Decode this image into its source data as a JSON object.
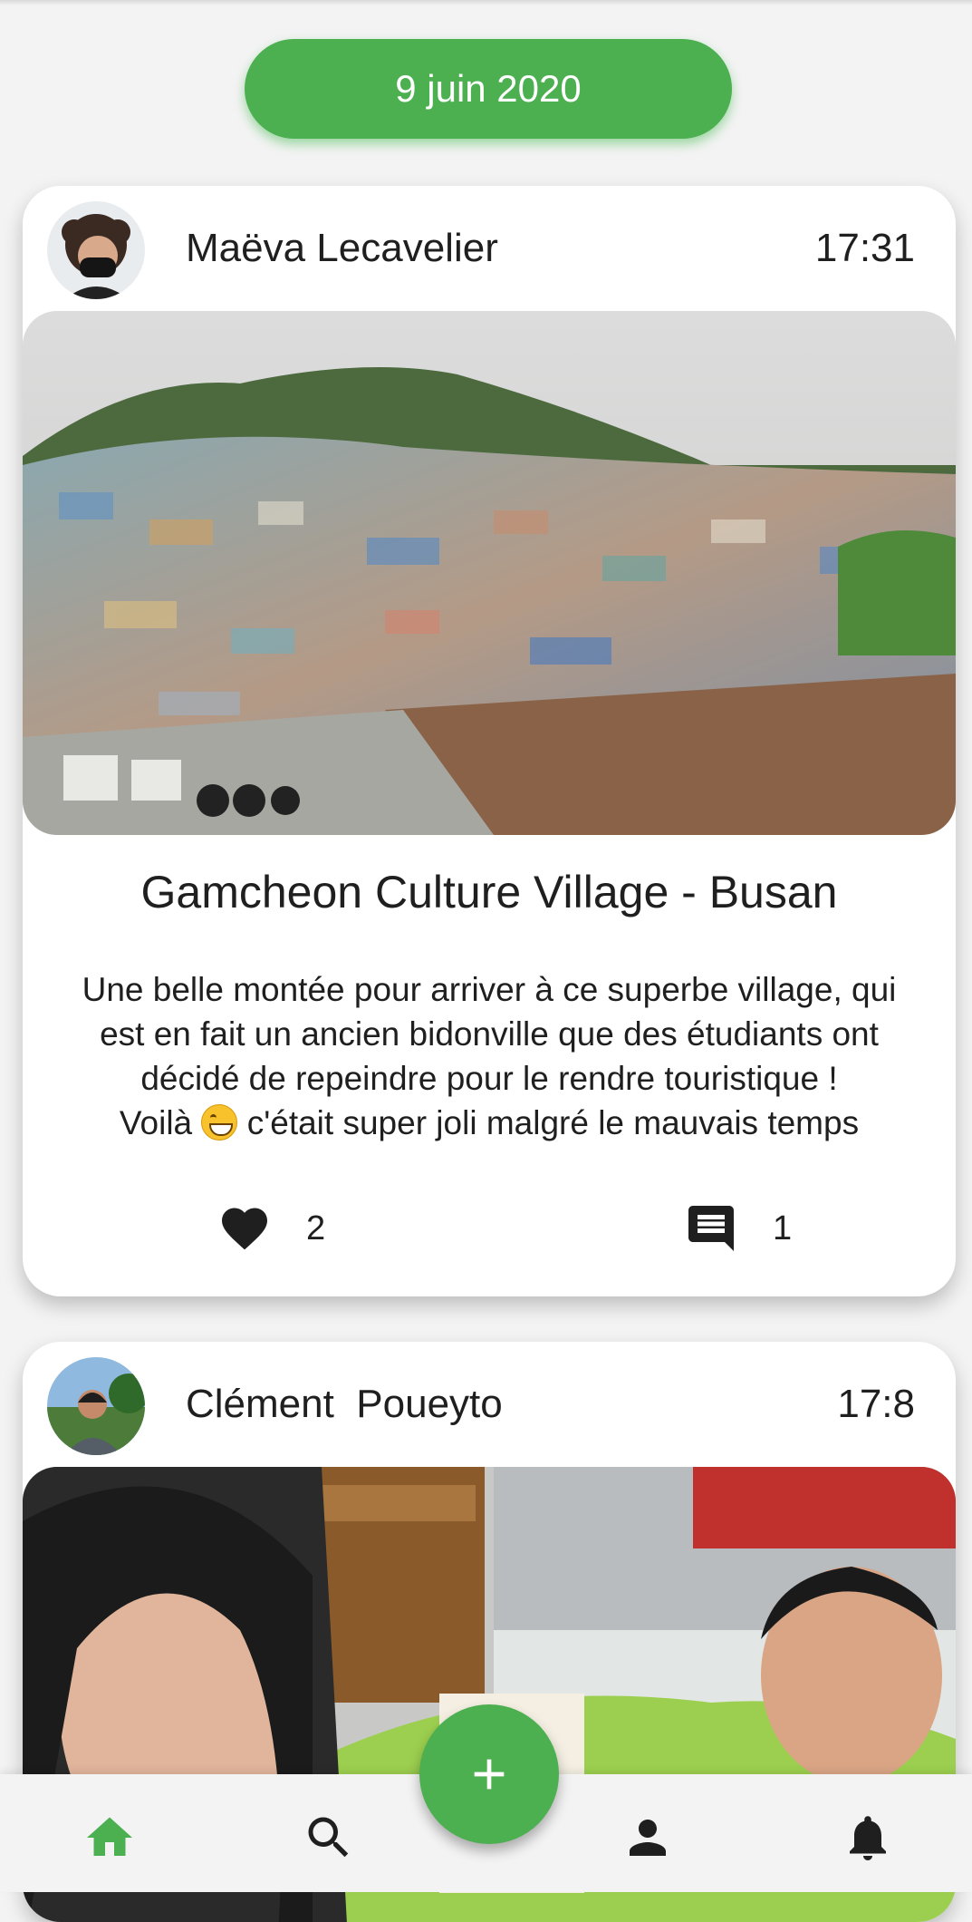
{
  "feed": {
    "date_label": "9 juin 2020",
    "posts": [
      {
        "author": "Maëva Lecavelier",
        "time": "17:31",
        "title": "Gamcheon Culture Village - Busan",
        "description_line1": "Une belle montée pour arriver à ce superbe village, qui",
        "description_line2": "est en fait un ancien bidonville que des étudiants ont",
        "description_line3": "décidé de repeindre pour le rendre touristique !",
        "description_line4a": "Voilà",
        "description_line4b": "c'était super joli malgré le mauvais temps",
        "likes": "2",
        "comments": "1"
      },
      {
        "author": "Clément  Poueyto",
        "time": "17:8"
      }
    ]
  },
  "nav": {
    "active_color": "#4caf50",
    "icons": [
      "home-icon",
      "search-icon",
      "add-icon",
      "profile-icon",
      "notifications-icon"
    ]
  }
}
